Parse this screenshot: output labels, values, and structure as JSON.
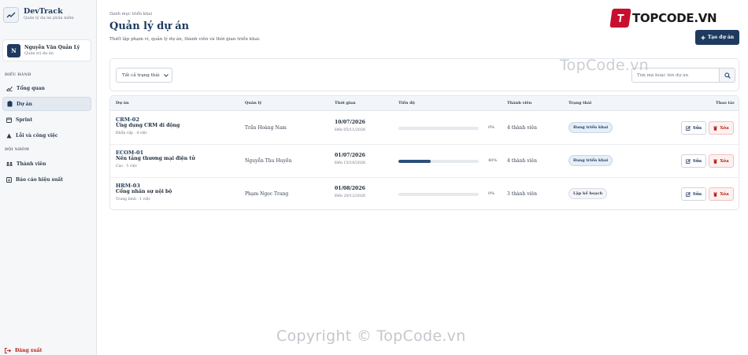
{
  "brand": {
    "title": "DevTrack",
    "subtitle": "Quản lý dự án phần mềm"
  },
  "user": {
    "initial": "N",
    "name": "Nguyễn Văn Quản Lý",
    "role": "Quản trị dự án"
  },
  "sidebar": {
    "group_manage": "ĐIỀU HÀNH",
    "group_team": "ĐỘI NHÓM",
    "items": [
      {
        "label": "Tổng quan",
        "icon": "chart-line-icon",
        "active": false
      },
      {
        "label": "Dự án",
        "icon": "clipboard-icon",
        "active": true
      },
      {
        "label": "Sprint",
        "icon": "calendar-icon",
        "active": false
      },
      {
        "label": "Lỗi và công việc",
        "icon": "bug-icon",
        "active": false
      },
      {
        "label": "Thành viên",
        "icon": "users-icon",
        "active": false
      },
      {
        "label": "Báo cáo hiệu suất",
        "icon": "report-icon",
        "active": false
      }
    ],
    "logout_label": "Đăng xuất"
  },
  "header": {
    "breadcrumb": "Danh mục triển khai",
    "title": "Quản lý dự án",
    "description": "Thiết lập phạm vi, quản lý dự án, thành viên và thời gian triển khai.",
    "create_label": "Tạo dự án"
  },
  "filter": {
    "status_selected": "Tất cả trạng thái",
    "search_placeholder": "Tìm mã hoặc tên dự án"
  },
  "table": {
    "columns": [
      "Dự án",
      "Quản lý",
      "Thời gian",
      "Tiến độ",
      "Thành viên",
      "Trạng thái",
      "Thao tác"
    ],
    "edit_label": "Sửa",
    "delete_label": "Xóa",
    "rows": [
      {
        "code": "CRM-02",
        "name": "Ứng dụng CRM di động",
        "meta": "Khẩn cấp · 4 việc",
        "manager": "Trần Hoàng Nam",
        "start": "10/07/2026",
        "end": "Đến 05/11/2026",
        "progress": 0,
        "progress_label": "0%",
        "members": "4 thành viên",
        "status": "Đang triển khai",
        "status_kind": "active"
      },
      {
        "code": "ECOM-01",
        "name": "Nền tảng thương mại điện tử",
        "meta": "Cao · 5 việc",
        "manager": "Nguyễn Thu Huyền",
        "start": "01/07/2026",
        "end": "Đến 15/10/2026",
        "progress": 40,
        "progress_label": "40%",
        "members": "4 thành viên",
        "status": "Đang triển khai",
        "status_kind": "active"
      },
      {
        "code": "HRM-03",
        "name": "Cổng nhân sự nội bộ",
        "meta": "Trung bình · 1 việc",
        "manager": "Phạm Ngọc Trang",
        "start": "01/08/2026",
        "end": "Đến 20/12/2026",
        "progress": 0,
        "progress_label": "0%",
        "members": "3 thành viên",
        "status": "Lập kế hoạch",
        "status_kind": "plan"
      }
    ]
  },
  "watermarks": {
    "logo": "TOPCODE.VN",
    "center": "TopCode.vn",
    "bottom": "Copyright © TopCode.vn"
  },
  "colors": {
    "primary": "#1e3a5f",
    "danger": "#b42318",
    "brand_red": "#c8102e"
  }
}
